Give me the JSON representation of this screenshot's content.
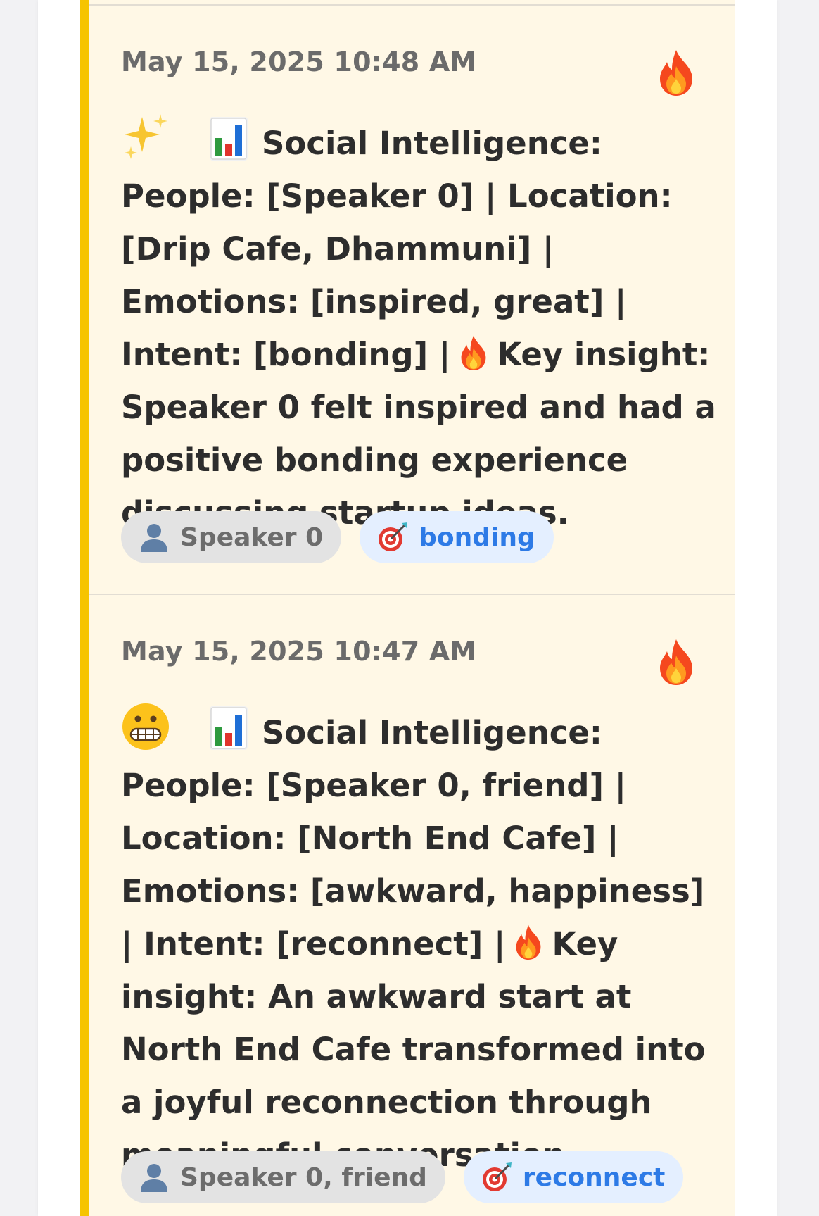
{
  "entries": [
    {
      "timestamp": "May 15, 2025 10:48 AM",
      "mood_icon": "sparkles-icon",
      "summary_line1": "Social Intelligence: People: [Speaker 0] | Location: [Drip Cafe, Dhammuni] | Emotions: [inspired, great] | Intent: [bonding] |",
      "summary_line2": "Key insight: Speaker 0 felt inspired and had a positive bonding experience discussing startup ideas.",
      "people_chip": "Speaker 0",
      "intent_chip": "bonding"
    },
    {
      "timestamp": "May 15, 2025 10:47 AM",
      "mood_icon": "grimacing-face-icon",
      "summary_line1": "Social Intelligence: People: [Speaker 0, friend] | Location: [North End Cafe] | Emotions: [awkward, happiness] | Intent: [reconnect] |",
      "summary_line2": "Key insight: An awkward start at North End Cafe transformed into a joyful reconnection through meaningful conversation.",
      "people_chip": "Speaker 0, friend",
      "intent_chip": "reconnect"
    }
  ],
  "colors": {
    "accent": "#f6c400",
    "card_background": "#fff8e6",
    "intent_text": "#2d7ae6"
  }
}
